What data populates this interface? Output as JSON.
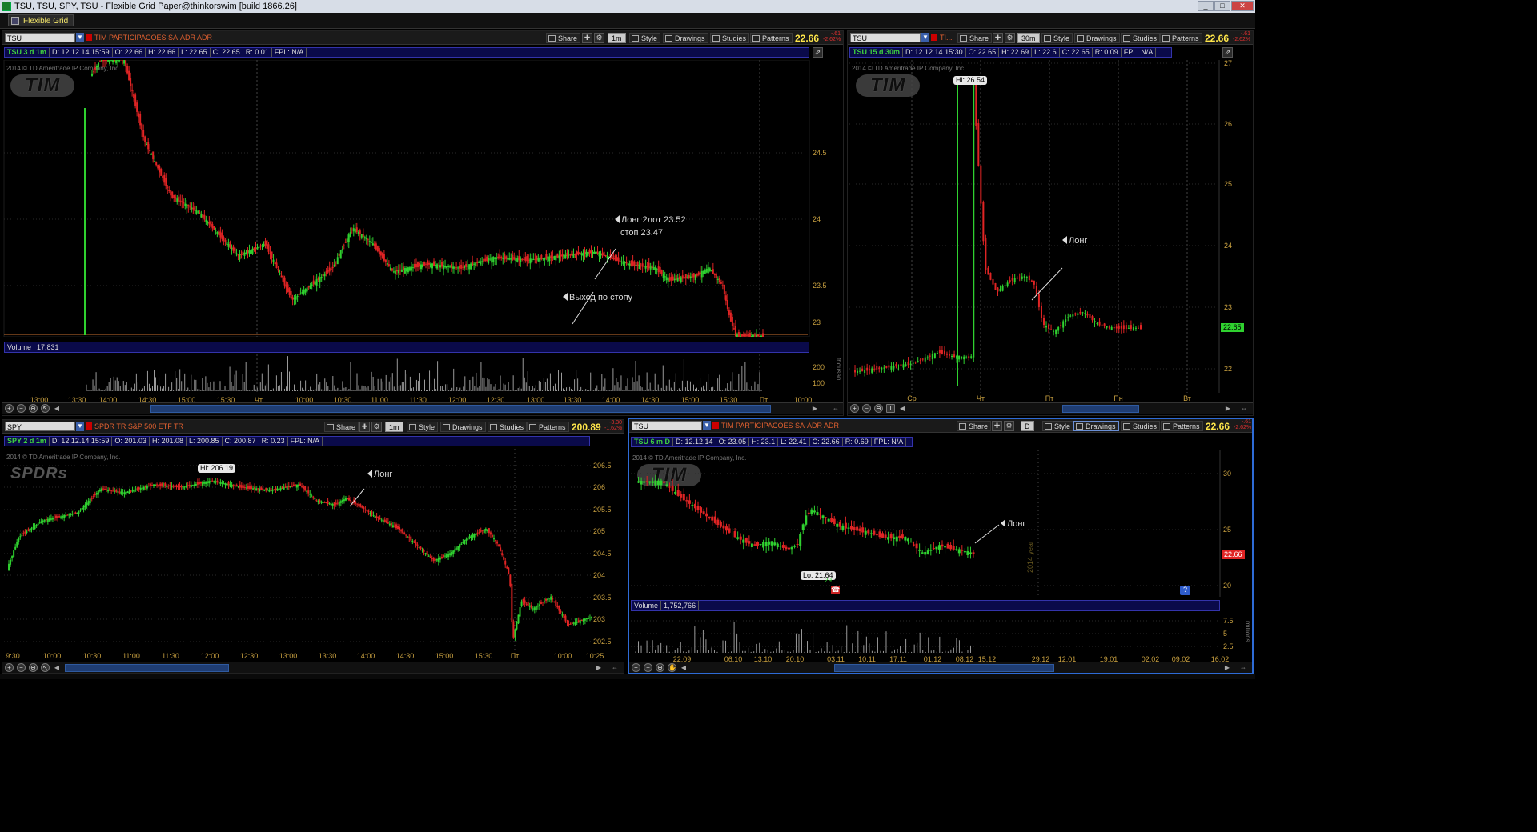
{
  "window": {
    "title": "TSU, TSU, SPY, TSU - Flexible Grid Paper@thinkorswim [build 1866.26]",
    "grid_tab": "Flexible Grid"
  },
  "toolbar_labels": {
    "share": "Share",
    "style": "Style",
    "drawings": "Drawings",
    "studies": "Studies",
    "patterns": "Patterns"
  },
  "panels": {
    "tl": {
      "symbol": "TSU",
      "description": "TIM PARTICIPACOES SA-ADR ADR",
      "timeframe": "1m",
      "price": "22.66",
      "change": "-.61",
      "change_pct": "-2.62%",
      "info": {
        "label": "TSU 3 d 1m",
        "date": "D: 12.12.14 15:59",
        "open": "O: 22.66",
        "high": "H: 22.66",
        "low": "L: 22.65",
        "close": "C: 22.65",
        "range": "R: 0.01",
        "fpl": "FPL: N/A"
      },
      "copyright": "2014 © TD Ameritrade IP Company, Inc.",
      "logo": "TIM",
      "volume_label": "Volume",
      "volume_value": "17,831",
      "volume_unit": "thousan...",
      "y_ticks": [
        "24.5",
        "24",
        "23.5",
        "23"
      ],
      "vol_ticks": [
        "200",
        "100"
      ],
      "x_ticks": [
        "13:00",
        "13:30",
        "14:00",
        "14:30",
        "15:00",
        "15:30",
        "Чт",
        "10:00",
        "10:30",
        "11:00",
        "11:30",
        "12:00",
        "12:30",
        "13:00",
        "13:30",
        "14:00",
        "14:30",
        "15:00",
        "15:30",
        "Пт",
        "10:00"
      ],
      "annotations": {
        "long_line1": "Лонг 2лот 23.52",
        "long_line2": "стоп 23.47",
        "exit": "Выход по стопу"
      }
    },
    "tr": {
      "symbol": "TSU",
      "description": "TI...",
      "timeframe": "30m",
      "price": "22.66",
      "change": "-.61",
      "change_pct": "-2.62%",
      "info": {
        "label": "TSU 15 d 30m",
        "date": "D: 12.12.14 15:30",
        "open": "O: 22.65",
        "high": "H: 22.69",
        "low": "L: 22.6",
        "close": "C: 22.65",
        "range": "R: 0.09",
        "fpl": "FPL: N/A"
      },
      "copyright": "2014 © TD Ameritrade IP Company, Inc.",
      "logo": "TIM",
      "hi_bubble": "Hi: 26.54",
      "last_tag": "22.65",
      "y_ticks": [
        "27",
        "26",
        "25",
        "24",
        "23",
        "22"
      ],
      "x_ticks": [
        "Ср",
        "Чт",
        "Пт",
        "Пн",
        "Вт"
      ],
      "annotations": {
        "long": "Лонг"
      }
    },
    "bl": {
      "symbol": "SPY",
      "description": "SPDR TR S&P 500 ETF TR",
      "timeframe": "1m",
      "price": "200.89",
      "change": "-3.30",
      "change_pct": "-1.62%",
      "info": {
        "label": "SPY 2 d 1m",
        "date": "D: 12.12.14 15:59",
        "open": "O: 201.03",
        "high": "H: 201.08",
        "low": "L: 200.85",
        "close": "C: 200.87",
        "range": "R: 0.23",
        "fpl": "FPL: N/A"
      },
      "copyright": "2014 © TD Ameritrade IP Company, Inc.",
      "logo": "SPDRs",
      "hi_bubble": "Hi: 206.19",
      "y_ticks": [
        "206.5",
        "206",
        "205.5",
        "205",
        "204.5",
        "204",
        "203.5",
        "203",
        "202.5"
      ],
      "x_ticks": [
        "9:30",
        "10:00",
        "10:30",
        "11:00",
        "11:30",
        "12:00",
        "12:30",
        "13:00",
        "13:30",
        "14:00",
        "14:30",
        "15:00",
        "15:30",
        "Пт",
        "10:00",
        "10:25"
      ],
      "annotations": {
        "long": "Лонг"
      }
    },
    "br": {
      "symbol": "TSU",
      "description": "TIM PARTICIPACOES SA-ADR ADR",
      "timeframe": "D",
      "price": "22.66",
      "change": "-.61",
      "change_pct": "-2.62%",
      "info": {
        "label": "TSU 6 m D",
        "date": "D: 12.12.14",
        "open": "O: 23.05",
        "high": "H: 23.1",
        "low": "L: 22.41",
        "close": "C: 22.66",
        "range": "R: 0.69",
        "fpl": "FPL: N/A"
      },
      "copyright": "2014 © TD Ameritrade IP Company, Inc.",
      "logo": "TIM",
      "lo_bubble": "Lo: 21.64",
      "last_tag": "22.66",
      "year_marker": "2014 year",
      "small_value": "29",
      "help_glyph": "?",
      "volume_label": "Volume",
      "volume_value": "1,752,766",
      "volume_unit": "millions",
      "y_ticks": [
        "30",
        "25",
        "20"
      ],
      "vol_ticks": [
        "7.5",
        "5",
        "2.5"
      ],
      "x_ticks": [
        "22.09",
        "06.10",
        "13.10",
        "20.10",
        "03.11",
        "10.11",
        "17.11",
        "01.12",
        "08.12",
        "15.12",
        "29.12",
        "12.01",
        "19.01",
        "02.02",
        "09.02",
        "16.02"
      ],
      "annotations": {
        "long": "Лонг"
      }
    }
  },
  "colors": {
    "up": "#2fd12f",
    "down": "#e02424",
    "price": "#ffe64a",
    "accent": "#2e6bd6"
  }
}
